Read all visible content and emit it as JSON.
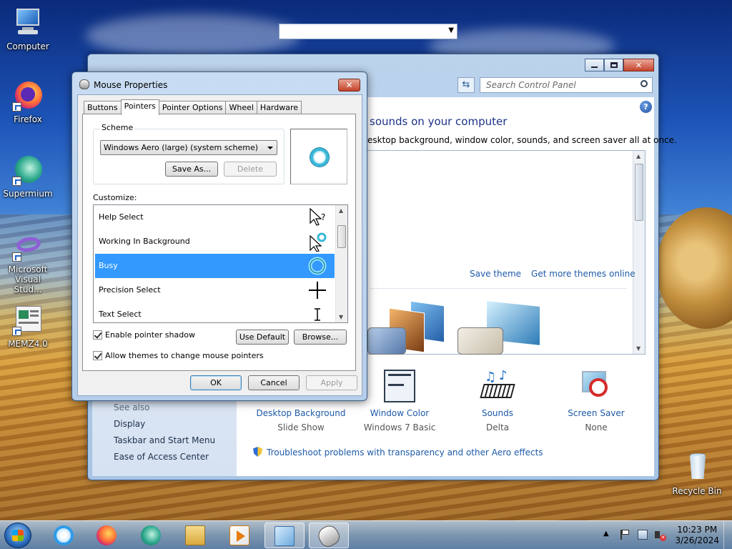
{
  "desktop": {
    "icons": [
      {
        "label": "Computer"
      },
      {
        "label": "Firefox"
      },
      {
        "label": "Supermium"
      },
      {
        "label": "Microsoft Visual Stud..."
      },
      {
        "label": "MEMZ4.0"
      },
      {
        "label": "Recycle Bin"
      }
    ]
  },
  "control_panel": {
    "search_placeholder": "Search Control Panel",
    "heading": "sounds on your computer",
    "subheading": "esktop background, window color, sounds, and screen saver all at once.",
    "save_theme": "Save theme",
    "get_more": "Get more themes online",
    "bottom_items": [
      {
        "title": "Desktop Background",
        "sub": "Slide Show"
      },
      {
        "title": "Window Color",
        "sub": "Windows 7 Basic"
      },
      {
        "title": "Sounds",
        "sub": "Delta"
      },
      {
        "title": "Screen Saver",
        "sub": "None"
      }
    ],
    "see_also": "See also",
    "left_links": [
      "Display",
      "Taskbar and Start Menu",
      "Ease of Access Center"
    ],
    "troubleshoot": "Troubleshoot problems with transparency and other Aero effects"
  },
  "dialog": {
    "title": "Mouse Properties",
    "close_label": "✕",
    "tabs": [
      "Buttons",
      "Pointers",
      "Pointer Options",
      "Wheel",
      "Hardware"
    ],
    "active_tab": "Pointers",
    "scheme_label": "Scheme",
    "scheme_value": "Windows Aero (large) (system scheme)",
    "save_as": "Save As...",
    "delete": "Delete",
    "customize_label": "Customize:",
    "cursor_rows": [
      "Help Select",
      "Working In Background",
      "Busy",
      "Precision Select",
      "Text Select"
    ],
    "selected_row": "Busy",
    "enable_shadow": "Enable pointer shadow",
    "use_default": "Use Default",
    "browse": "Browse...",
    "allow_themes": "Allow themes to change mouse pointers",
    "ok": "OK",
    "cancel": "Cancel",
    "apply": "Apply"
  },
  "taskbar": {
    "time": "10:23 PM",
    "date": "3/26/2024"
  }
}
